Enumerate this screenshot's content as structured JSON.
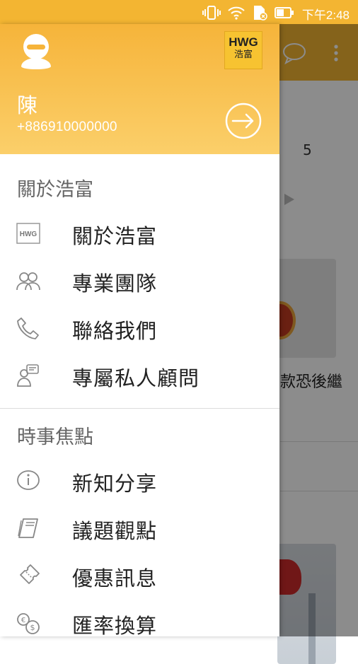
{
  "status_bar": {
    "time": "下午2:48"
  },
  "background": {
    "tab_number": "5",
    "headline_fragment": "款恐後繼"
  },
  "drawer": {
    "logo": {
      "line1": "HWG",
      "line2": "浩富"
    },
    "user": {
      "name": "陳",
      "phone": "+886910000000"
    },
    "sections": [
      {
        "title": "關於浩富",
        "items": [
          {
            "label": "關於浩富",
            "icon": "hwg-logo-icon"
          },
          {
            "label": "專業團隊",
            "icon": "team-icon"
          },
          {
            "label": "聯絡我們",
            "icon": "phone-icon"
          },
          {
            "label": "專屬私人顧問",
            "icon": "advisor-icon"
          }
        ]
      },
      {
        "title": "時事焦點",
        "items": [
          {
            "label": "新知分享",
            "icon": "info-icon"
          },
          {
            "label": "議題觀點",
            "icon": "book-icon"
          },
          {
            "label": "優惠訊息",
            "icon": "ticket-icon"
          },
          {
            "label": "匯率換算",
            "icon": "currency-exchange-icon"
          }
        ]
      }
    ]
  },
  "colors": {
    "header_yellow": "#f6b43a",
    "status_bar": "#f3b532"
  }
}
